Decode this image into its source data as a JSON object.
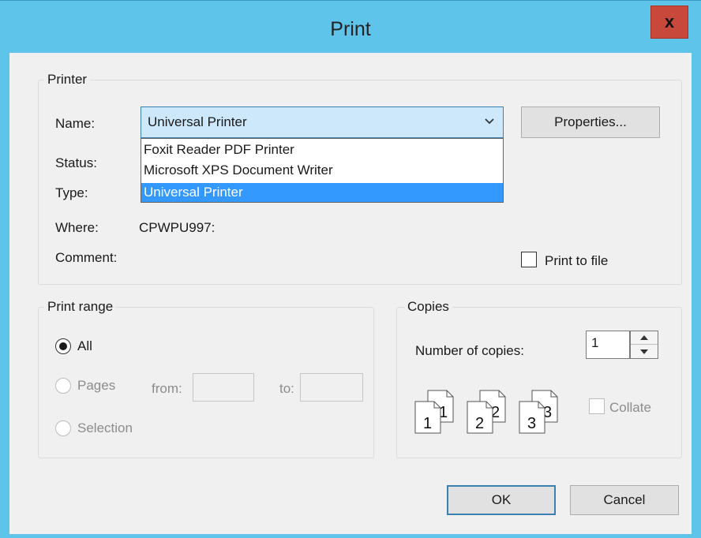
{
  "window": {
    "title": "Print",
    "close_glyph": "x"
  },
  "printer": {
    "legend": "Printer",
    "name_label": "Name:",
    "selected": "Universal Printer",
    "options": [
      "Foxit Reader PDF Printer",
      "Microsoft XPS Document Writer",
      "Universal Printer"
    ],
    "properties_label": "Properties...",
    "status_label": "Status:",
    "type_label": "Type:",
    "where_label": "Where:",
    "where_value": "CPWPU997:",
    "comment_label": "Comment:",
    "print_to_file_label": "Print to file",
    "print_to_file_checked": false
  },
  "print_range": {
    "legend": "Print range",
    "all_label": "All",
    "all_selected": true,
    "pages_label": "Pages",
    "from_label": "from:",
    "to_label": "to:",
    "from_value": "",
    "to_value": "",
    "selection_label": "Selection"
  },
  "copies": {
    "legend": "Copies",
    "number_label": "Number of copies:",
    "number_value": "1",
    "collate_label": "Collate",
    "collate_checked": false,
    "collate_pages": [
      "1",
      "1",
      "2",
      "2",
      "3",
      "3"
    ]
  },
  "buttons": {
    "ok": "OK",
    "cancel": "Cancel"
  },
  "colors": {
    "titlebar": "#5ec4ea",
    "close": "#c9483c",
    "selection": "#3399ff",
    "accent": "#3c7fb1"
  },
  "icons": {
    "close": "close-icon",
    "dropdown": "chevron-down-icon",
    "spin_up": "spin-up-icon",
    "spin_down": "spin-down-icon",
    "collate": "collate-pages-icon"
  }
}
